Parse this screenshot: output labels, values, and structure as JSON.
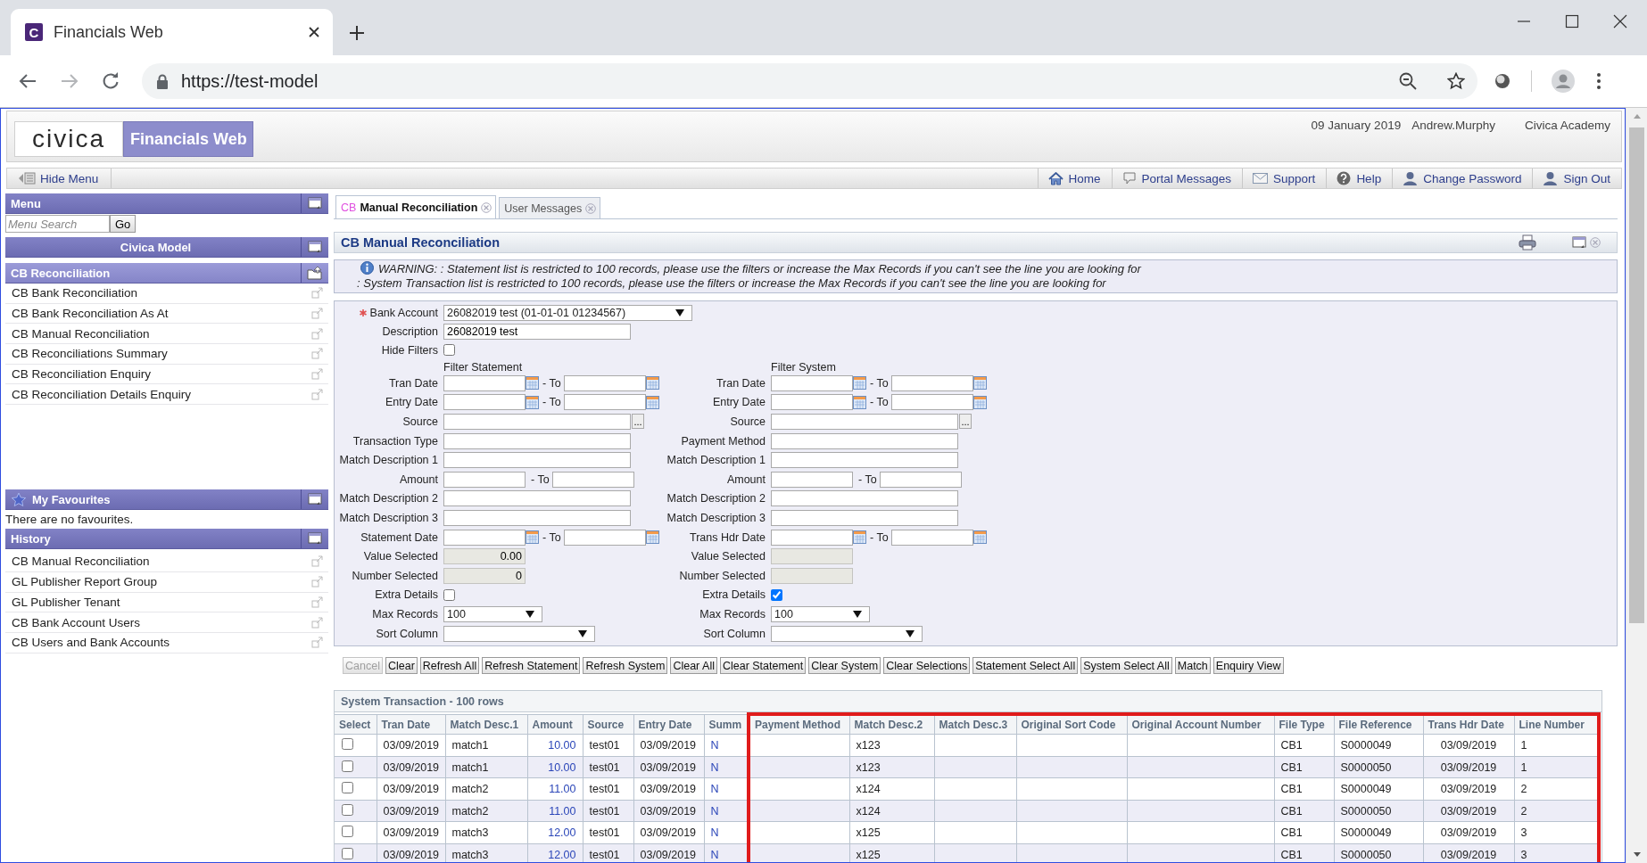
{
  "browser": {
    "favicon": "C",
    "tab_title": "Financials Web",
    "url": "https://test-model"
  },
  "header": {
    "logo": "civica",
    "product": "Financials Web",
    "date": "09 January 2019",
    "user": "Andrew.Murphy",
    "organisation": "Civica Academy"
  },
  "toolbar": {
    "hide_menu": "Hide Menu",
    "links": [
      "Home",
      "Portal Messages",
      "Support",
      "Help",
      "Change Password",
      "Sign Out"
    ]
  },
  "sidebar": {
    "menu": {
      "title": "Menu",
      "search_placeholder": "Menu Search",
      "go": "Go"
    },
    "model": "Civica Model",
    "section": {
      "title": "CB Reconciliation",
      "items": [
        "CB Bank Reconciliation",
        "CB Bank Reconciliation As At",
        "CB Manual Reconciliation",
        "CB Reconciliations Summary",
        "CB Reconciliation Enquiry",
        "CB Reconciliation Details Enquiry"
      ]
    },
    "favourites": {
      "title": "My Favourites",
      "empty": "There are no favourites."
    },
    "history": {
      "title": "History",
      "items": [
        "CB Manual Reconciliation",
        "GL Publisher Report Group",
        "GL Publisher Tenant",
        "CB Bank Account Users",
        "CB Users and Bank Accounts"
      ]
    }
  },
  "tabs": [
    {
      "prefix": "CB",
      "label": "Manual Reconciliation",
      "selected": true
    },
    {
      "label": "User Messages",
      "selected": false
    }
  ],
  "panel": {
    "title": "CB Manual Reconciliation",
    "warnings": [
      "WARNING: : Statement list is restricted to 100 records, please use the filters or increase the Max Records if you can't see the line you are looking for",
      ": System Transaction list is restricted to 100 records, please use the filters or increase the Max Records if you can't see the line you are looking for"
    ]
  },
  "form": {
    "top": [
      {
        "kind": "select",
        "label": "Bank Account",
        "required": true,
        "value": "26082019 test (01-01-01 01234567)"
      },
      {
        "kind": "text",
        "label": "Description",
        "value": "26082019 test"
      },
      {
        "kind": "checkbox",
        "label": "Hide Filters",
        "checked": false
      }
    ],
    "columns": [
      {
        "heading": "Filter Statement",
        "rows": [
          {
            "kind": "daterange",
            "label": "Tran Date",
            "to": "- To"
          },
          {
            "kind": "daterange",
            "label": "Entry Date",
            "to": "- To"
          },
          {
            "kind": "lookup",
            "label": "Source",
            "button": "..."
          },
          {
            "kind": "text",
            "label": "Transaction Type"
          },
          {
            "kind": "text",
            "label": "Match Description 1"
          },
          {
            "kind": "range",
            "label": "Amount",
            "to": "- To"
          },
          {
            "kind": "text",
            "label": "Match Description 2"
          },
          {
            "kind": "text",
            "label": "Match Description 3"
          },
          {
            "kind": "daterange",
            "label": "Statement Date",
            "to": "- To"
          },
          {
            "kind": "readonly",
            "label": "Value Selected",
            "value": "0.00"
          },
          {
            "kind": "readonly",
            "label": "Number Selected",
            "value": "0"
          },
          {
            "kind": "checkbox",
            "label": "Extra Details",
            "checked": false
          },
          {
            "kind": "select",
            "label": "Max Records",
            "value": "100"
          },
          {
            "kind": "wideselect",
            "label": "Sort Column"
          }
        ]
      },
      {
        "heading": "Filter System",
        "rows": [
          {
            "kind": "daterange",
            "label": "Tran Date",
            "to": "- To"
          },
          {
            "kind": "daterange",
            "label": "Entry Date",
            "to": "- To"
          },
          {
            "kind": "lookup",
            "label": "Source",
            "button": "..."
          },
          {
            "kind": "text",
            "label": "Payment Method"
          },
          {
            "kind": "text",
            "label": "Match Description 1"
          },
          {
            "kind": "range",
            "label": "Amount",
            "to": "- To"
          },
          {
            "kind": "text",
            "label": "Match Description 2"
          },
          {
            "kind": "text",
            "label": "Match Description 3"
          },
          {
            "kind": "daterange",
            "label": "Trans Hdr Date",
            "to": "- To"
          },
          {
            "kind": "readonly",
            "label": "Value Selected"
          },
          {
            "kind": "readonly",
            "label": "Number Selected"
          },
          {
            "kind": "checkbox",
            "label": "Extra Details",
            "checked": true
          },
          {
            "kind": "select",
            "label": "Max Records",
            "value": "100"
          },
          {
            "kind": "wideselect",
            "label": "Sort Column"
          }
        ]
      }
    ]
  },
  "actions": [
    {
      "label": "Cancel",
      "disabled": true
    },
    {
      "label": "Clear",
      "disabled": false
    },
    {
      "label": "Refresh All",
      "disabled": false
    },
    {
      "label": "Refresh Statement",
      "disabled": false
    },
    {
      "label": "Refresh System",
      "disabled": false
    },
    {
      "label": "Clear All",
      "disabled": false
    },
    {
      "label": "Clear Statement",
      "disabled": false
    },
    {
      "label": "Clear System",
      "disabled": false
    },
    {
      "label": "Clear Selections",
      "disabled": false
    },
    {
      "label": "Statement Select All",
      "disabled": false
    },
    {
      "label": "System Select All",
      "disabled": false
    },
    {
      "label": "Match",
      "disabled": false
    },
    {
      "label": "Enquiry View",
      "disabled": false
    }
  ],
  "grid": {
    "title": "System Transaction - 100 rows",
    "columns": [
      {
        "label": "Select",
        "kind": "check",
        "highlighted": false
      },
      {
        "label": "Tran Date",
        "kind": "text",
        "highlighted": false
      },
      {
        "label": "Match Desc.1",
        "kind": "text",
        "highlighted": false
      },
      {
        "label": "Amount",
        "kind": "amount",
        "highlighted": false
      },
      {
        "label": "Source",
        "kind": "text",
        "highlighted": false
      },
      {
        "label": "Entry Date",
        "kind": "text",
        "highlighted": false
      },
      {
        "label": "Summ",
        "kind": "flag",
        "highlighted": false
      },
      {
        "label": "Payment Method",
        "kind": "text",
        "highlighted": true
      },
      {
        "label": "Match Desc.2",
        "kind": "text",
        "highlighted": true
      },
      {
        "label": "Match Desc.3",
        "kind": "text",
        "highlighted": true
      },
      {
        "label": "Original Sort Code",
        "kind": "text",
        "highlighted": true
      },
      {
        "label": "Original Account Number",
        "kind": "text",
        "highlighted": true
      },
      {
        "label": "File Type",
        "kind": "text",
        "highlighted": true
      },
      {
        "label": "File Reference",
        "kind": "text",
        "highlighted": true
      },
      {
        "label": "Trans Hdr Date",
        "kind": "center",
        "highlighted": true
      },
      {
        "label": "Line Number",
        "kind": "text",
        "highlighted": true
      }
    ],
    "rows": [
      {
        "selected": false,
        "cells": [
          "",
          "03/09/2019",
          "match1",
          "10.00",
          "test01",
          "03/09/2019",
          "N",
          "",
          "x123",
          "",
          "",
          "",
          "CB1",
          "S0000049",
          "03/09/2019",
          "1"
        ]
      },
      {
        "selected": false,
        "cells": [
          "",
          "03/09/2019",
          "match1",
          "10.00",
          "test01",
          "03/09/2019",
          "N",
          "",
          "x123",
          "",
          "",
          "",
          "CB1",
          "S0000050",
          "03/09/2019",
          "1"
        ]
      },
      {
        "selected": false,
        "cells": [
          "",
          "03/09/2019",
          "match2",
          "11.00",
          "test01",
          "03/09/2019",
          "N",
          "",
          "x124",
          "",
          "",
          "",
          "CB1",
          "S0000049",
          "03/09/2019",
          "2"
        ]
      },
      {
        "selected": false,
        "cells": [
          "",
          "03/09/2019",
          "match2",
          "11.00",
          "test01",
          "03/09/2019",
          "N",
          "",
          "x124",
          "",
          "",
          "",
          "CB1",
          "S0000050",
          "03/09/2019",
          "2"
        ]
      },
      {
        "selected": false,
        "cells": [
          "",
          "03/09/2019",
          "match3",
          "12.00",
          "test01",
          "03/09/2019",
          "N",
          "",
          "x125",
          "",
          "",
          "",
          "CB1",
          "S0000049",
          "03/09/2019",
          "3"
        ]
      },
      {
        "selected": false,
        "cells": [
          "",
          "03/09/2019",
          "match3",
          "12.00",
          "test01",
          "03/09/2019",
          "N",
          "",
          "x125",
          "",
          "",
          "",
          "CB1",
          "S0000050",
          "03/09/2019",
          "3"
        ]
      }
    ]
  }
}
